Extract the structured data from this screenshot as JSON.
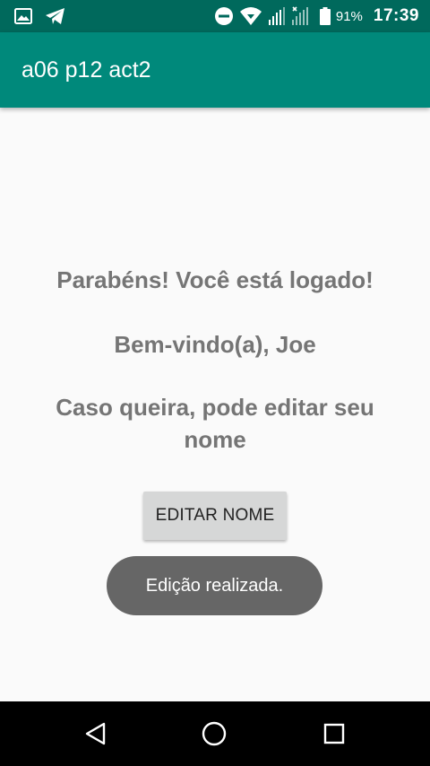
{
  "status_bar": {
    "battery_percent": "91%",
    "time": "17:39",
    "icons": [
      "image-icon",
      "telegram-icon",
      "do-not-disturb-icon",
      "wifi-icon",
      "signal-icon",
      "signal-no-sim-icon",
      "battery-icon"
    ]
  },
  "app_bar": {
    "title": "a06 p12 act2"
  },
  "main": {
    "congrats": "Parabéns! Você está logado!",
    "welcome": "Bem-vindo(a), Joe",
    "edit_prompt": "Caso queira, pode editar seu nome",
    "edit_button": "EDITAR NOME"
  },
  "toast": {
    "message": "Edição realizada."
  },
  "nav_bar": {
    "icons": [
      "back-icon",
      "home-icon",
      "recents-icon"
    ]
  },
  "colors": {
    "status_bar": "#00695c",
    "app_bar": "#00897b",
    "background": "#fafafa",
    "text": "#757575",
    "button": "#d6d7d7",
    "toast": "#666666"
  }
}
